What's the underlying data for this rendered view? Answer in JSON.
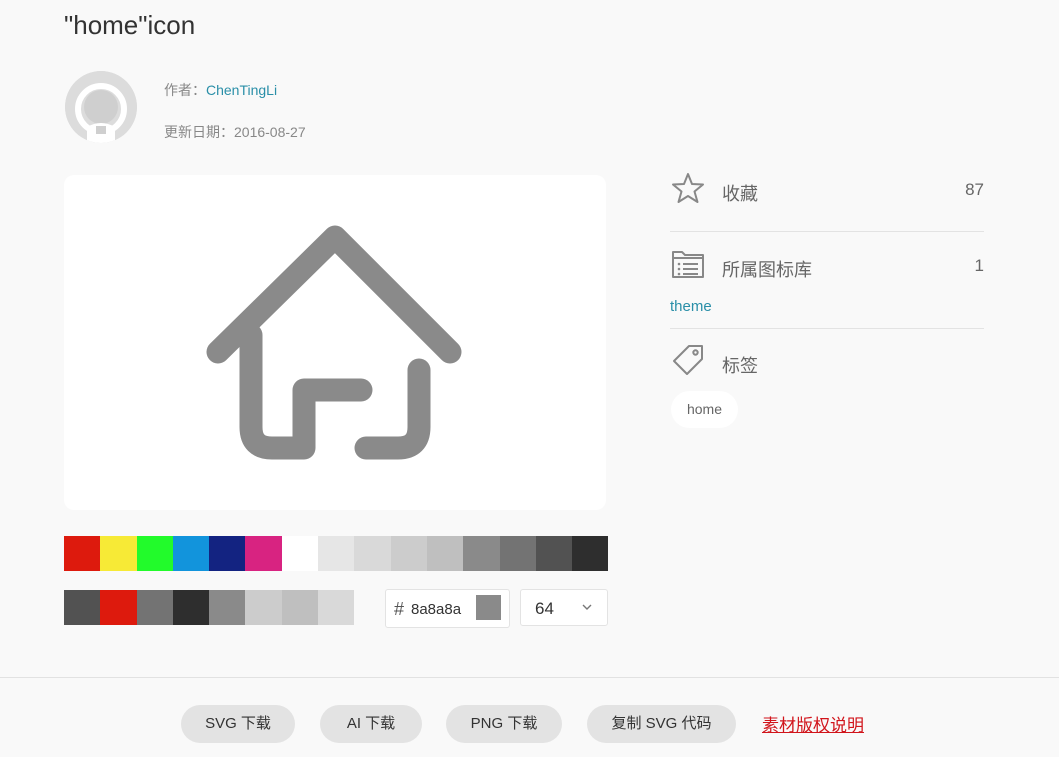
{
  "page": {
    "title": "\"home\"icon"
  },
  "author": {
    "label": "作者：",
    "name": "ChenTingLi"
  },
  "updated": {
    "label": "更新日期：",
    "date": "2016-08-27"
  },
  "preview": {
    "icon_name": "home-icon",
    "color": "#8a8a8a"
  },
  "palette": {
    "row1": [
      "#dd1a0d",
      "#f7ea36",
      "#22fb2b",
      "#1294dc",
      "#132381",
      "#d82381",
      "#ffffff",
      "#e6e6e6",
      "#d9d9d9",
      "#cccccc",
      "#bfbfbf",
      "#8a8a8a",
      "#737373",
      "#525252",
      "#2e2e2e"
    ],
    "row2": [
      "#525252",
      "#dd1a0d",
      "#737373",
      "#2e2e2e",
      "#8a8a8a",
      "#cccccc",
      "#bfbfbf",
      "#d9d9d9"
    ]
  },
  "color_input": {
    "hash": "#",
    "value": "8a8a8a",
    "swatch": "#8a8a8a"
  },
  "size_select": {
    "value": "64"
  },
  "sidebar": {
    "favorites": {
      "label": "收藏",
      "count": "87"
    },
    "library": {
      "label": "所属图标库",
      "count": "1",
      "link": "theme"
    },
    "tags": {
      "label": "标签",
      "items": [
        "home"
      ]
    }
  },
  "footer": {
    "svg_download": "SVG 下载",
    "ai_download": "AI 下载",
    "png_download": "PNG 下载",
    "copy_svg": "复制 SVG 代码",
    "copyright": "素材版权说明"
  }
}
